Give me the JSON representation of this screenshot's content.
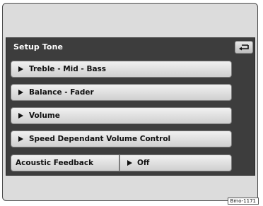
{
  "screen": {
    "title": "Setup Tone",
    "back_icon": "return-arrow-icon"
  },
  "menu": {
    "items": [
      {
        "label": "Treble - Mid - Bass"
      },
      {
        "label": "Balance - Fader"
      },
      {
        "label": "Volume"
      },
      {
        "label": "Speed Dependant Volume Control"
      }
    ],
    "acoustic_feedback": {
      "label": "Acoustic Feedback",
      "value": "Off"
    }
  },
  "figure_ref": "Bmo-1171",
  "colors": {
    "panel_bg": "#3d3d3d",
    "frame_bg": "#dcdcdc",
    "button_bg": "#e0e0e0",
    "title_text": "#ffffff"
  }
}
